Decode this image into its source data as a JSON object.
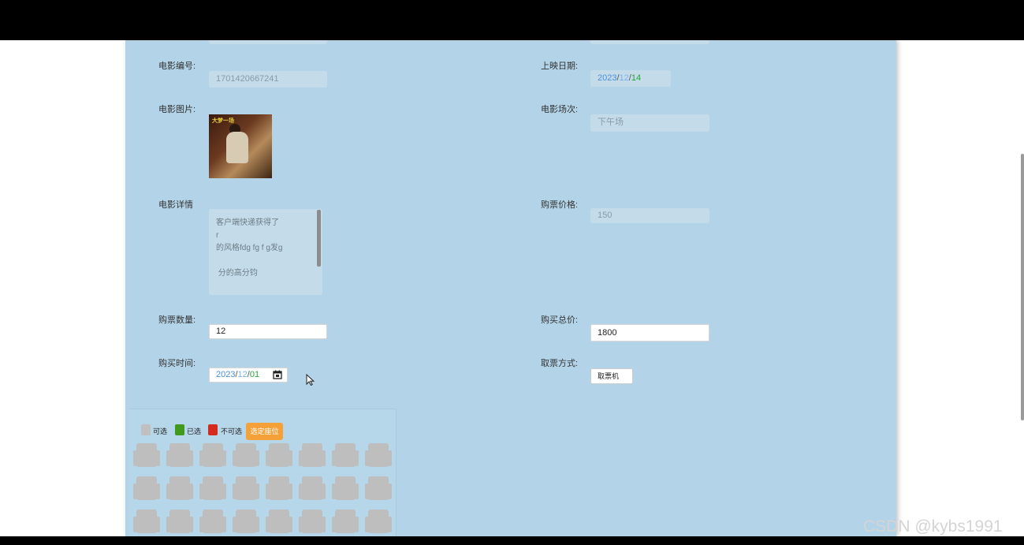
{
  "form": {
    "movie_id": {
      "label": "电影编号:",
      "value": "1701420667241"
    },
    "release_date": {
      "label": "上映日期:",
      "year": "2023",
      "month": "12",
      "day": "14"
    },
    "movie_image": {
      "label": "电影图片:",
      "poster_text": "大梦一场"
    },
    "showing": {
      "label": "电影场次:",
      "value": "下午场"
    },
    "details": {
      "label": "电影详情",
      "lines": [
        "客户端快递获得了",
        "r",
        "的风格fdg fg f g发g",
        "",
        " 分的高分钧"
      ]
    },
    "ticket_price": {
      "label": "购票价格:",
      "value": "150"
    },
    "ticket_qty": {
      "label": "购票数量:",
      "value": "12"
    },
    "total_price": {
      "label": "购买总价:",
      "value": "1800"
    },
    "purchase_time": {
      "label": "购买时间:",
      "year": "2023",
      "month": "12",
      "day": "01"
    },
    "pickup": {
      "label": "取票方式:",
      "value": "取票机"
    }
  },
  "seats": {
    "legend": [
      {
        "label": "可选",
        "color": "#c0c0c0"
      },
      {
        "label": "已选",
        "color": "#3f9a1e"
      },
      {
        "label": "不可选",
        "color": "#d42b1e"
      }
    ],
    "confirm_button": "选定座位",
    "seat_color": "#bebebe",
    "rows": [
      [
        "available",
        "available",
        "available",
        "available",
        "available",
        "available",
        "available",
        "available"
      ],
      [
        "available",
        "available",
        "available",
        "available",
        "available",
        "available",
        "available",
        "available"
      ],
      [
        "available",
        "available",
        "available",
        "available",
        "available",
        "available",
        "available",
        "available"
      ]
    ]
  },
  "watermark": "CSDN @kybs1991"
}
